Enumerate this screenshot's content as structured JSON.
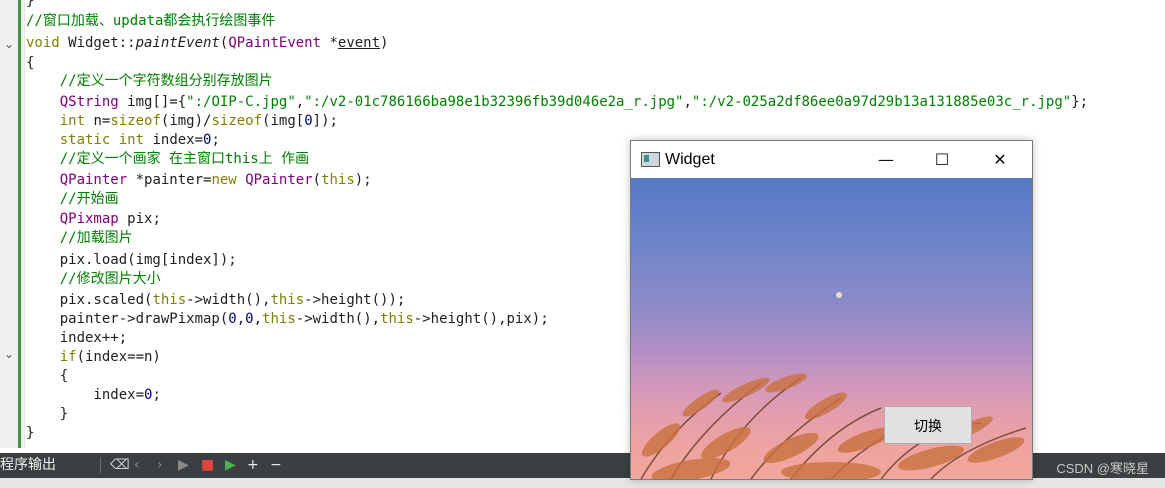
{
  "editor": {
    "lines": [
      "}",
      "//窗口加载、updata都会执行绘图事件",
      "void Widget::paintEvent(QPaintEvent *event)",
      "{",
      "    //定义一个字符数组分别存放图片",
      "    QString img[]={\":/OIP-C.jpg\",\":/v2-01c786166ba98e1b32396fb39d046e2a_r.jpg\",\":/v2-025a2df86ee0a97d29b13a131885e03c_r.jpg\"};",
      "    int n=sizeof(img)/sizeof(img[0]);",
      "    static int index=0;",
      "    //定义一个画家 在主窗口this上 作画",
      "    QPainter *painter=new QPainter(this);",
      "    //开始画",
      "    QPixmap pix;",
      "    //加载图片",
      "    pix.load(img[index]);",
      "    //修改图片大小",
      "    pix.scaled(this->width(),this->height());",
      "    painter->drawPixmap(0,0,this->width(),this->height(),pix);",
      "    index++;",
      "    if(index==n)",
      "    {",
      "        index=0;",
      "    }",
      "}"
    ]
  },
  "bottom_panel": {
    "label": "程序输出"
  },
  "widget_window": {
    "title": "Widget",
    "minimize": "—",
    "maximize": "☐",
    "close": "✕",
    "switch_button": "切换"
  },
  "watermark": "CSDN @寒晓星",
  "colors": {
    "comment": "#008000",
    "keyword": "#808000",
    "type": "#800080",
    "number": "#000080"
  }
}
